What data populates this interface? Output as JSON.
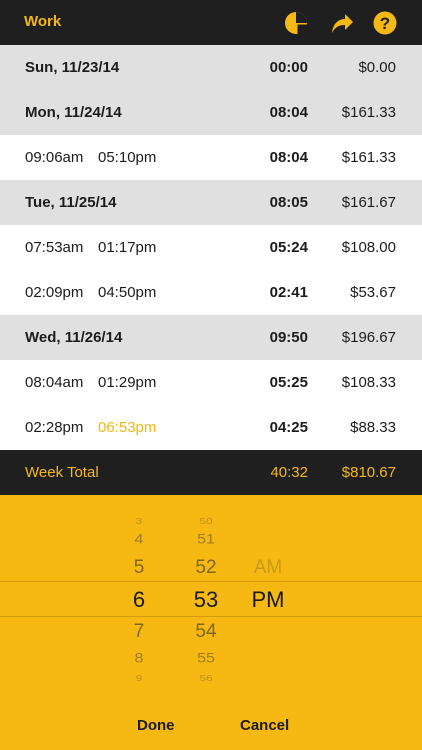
{
  "header": {
    "title": "Work",
    "icons": [
      "pie-chart-icon",
      "share-arrow-icon",
      "help-icon"
    ],
    "accent_color": "#f6b913"
  },
  "rows": [
    {
      "type": "day",
      "label": "Sun, 11/23/14",
      "hours": "00:00",
      "amount": "$0.00"
    },
    {
      "type": "day",
      "label": "Mon, 11/24/14",
      "hours": "08:04",
      "amount": "$161.33"
    },
    {
      "type": "entry",
      "start": "09:06am",
      "end": "05:10pm",
      "hours": "08:04",
      "amount": "$161.33"
    },
    {
      "type": "day",
      "label": "Tue, 11/25/14",
      "hours": "08:05",
      "amount": "$161.67"
    },
    {
      "type": "entry",
      "start": "07:53am",
      "end": "01:17pm",
      "hours": "05:24",
      "amount": "$108.00"
    },
    {
      "type": "entry",
      "start": "02:09pm",
      "end": "04:50pm",
      "hours": "02:41",
      "amount": "$53.67"
    },
    {
      "type": "day",
      "label": "Wed, 11/26/14",
      "hours": "09:50",
      "amount": "$196.67"
    },
    {
      "type": "entry",
      "start": "08:04am",
      "end": "01:29pm",
      "hours": "05:25",
      "amount": "$108.33"
    },
    {
      "type": "entry",
      "start": "02:28pm",
      "end": "06:53pm",
      "hours": "04:25",
      "amount": "$88.33"
    }
  ],
  "week_total": {
    "label": "Week Total",
    "hours": "40:32",
    "amount": "$810.67"
  },
  "picker": {
    "hours": [
      "3",
      "4",
      "5",
      "6",
      "7",
      "8",
      "9"
    ],
    "minutes": [
      "50",
      "51",
      "52",
      "53",
      "54",
      "55",
      "56"
    ],
    "ampm": [
      "AM",
      "PM"
    ],
    "selected_hour": "6",
    "selected_minute": "53",
    "selected_ampm": "PM",
    "done_label": "Done",
    "cancel_label": "Cancel"
  }
}
